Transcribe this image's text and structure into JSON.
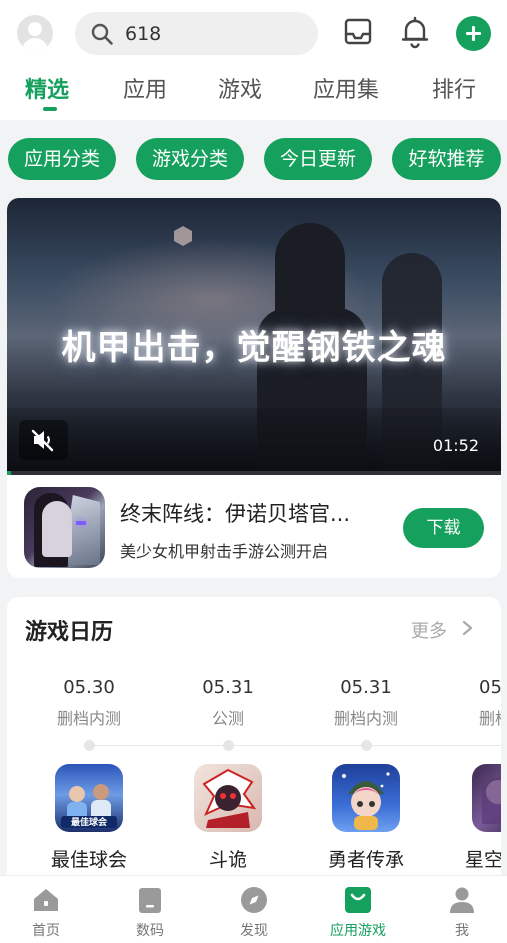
{
  "header": {
    "search": {
      "value": "618",
      "placeholder": ""
    },
    "tabs": [
      {
        "label": "精选",
        "active": true
      },
      {
        "label": "应用",
        "active": false
      },
      {
        "label": "游戏",
        "active": false
      },
      {
        "label": "应用集",
        "active": false
      },
      {
        "label": "排行",
        "active": false
      }
    ]
  },
  "chips": [
    "应用分类",
    "游戏分类",
    "今日更新",
    "好软推荐"
  ],
  "featured": {
    "video_title": "机甲出击，觉醒钢铁之魂",
    "duration": "01:52",
    "app_name": "终末阵线：伊诺贝塔官...",
    "app_desc": "美少女机甲射击手游公测开启",
    "download_label": "下载"
  },
  "calendar": {
    "title": "游戏日历",
    "more_label": "更多",
    "entries": [
      {
        "date": "05.30",
        "status": "删档内测",
        "name": "最佳球会"
      },
      {
        "date": "05.31",
        "status": "公测",
        "name": "斗诡"
      },
      {
        "date": "05.31",
        "status": "删档内测",
        "name": "勇者传承"
      },
      {
        "date": "05",
        "status": "删档",
        "name": "星空"
      }
    ]
  },
  "bottom_nav": [
    {
      "label": "首页",
      "icon": "home-icon",
      "active": false
    },
    {
      "label": "数码",
      "icon": "digital-icon",
      "active": false
    },
    {
      "label": "发现",
      "icon": "compass-icon",
      "active": false
    },
    {
      "label": "应用游戏",
      "icon": "app-store-bag-icon",
      "active": true
    },
    {
      "label": "我",
      "icon": "profile-icon",
      "active": false
    }
  ],
  "colors": {
    "accent": "#16a05d"
  }
}
